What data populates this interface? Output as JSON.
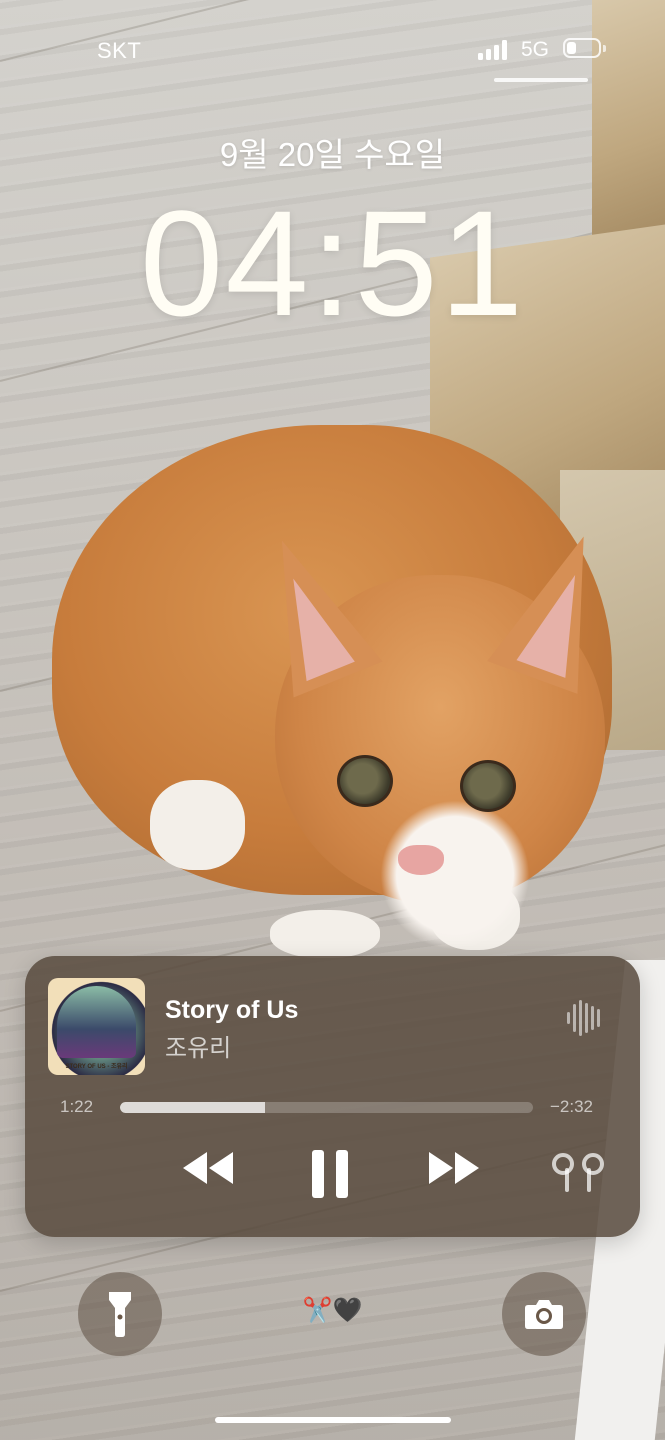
{
  "status_bar": {
    "carrier": "SKT",
    "network": "5G",
    "signal_bars": 4,
    "battery_level": 0.25
  },
  "lock_screen": {
    "date": "9월 20일 수요일",
    "time": "04:51"
  },
  "now_playing": {
    "title": "Story of Us",
    "artist": "조유리",
    "album_art_caption": "STORY OF US - 조유리",
    "elapsed": "1:22",
    "remaining": "−2:32",
    "progress": 0.35
  },
  "bottom_bar": {
    "emoji_text": "✂️🖤"
  },
  "icons": {
    "rewind": "backward-icon",
    "pause": "pause-icon",
    "forward": "forward-icon",
    "airplay": "airpods-icon",
    "flashlight": "flashlight-icon",
    "camera": "camera-icon",
    "waveform": "waveform-icon"
  },
  "colors": {
    "player_background": "#584a3e",
    "text_primary": "#ffffff"
  }
}
